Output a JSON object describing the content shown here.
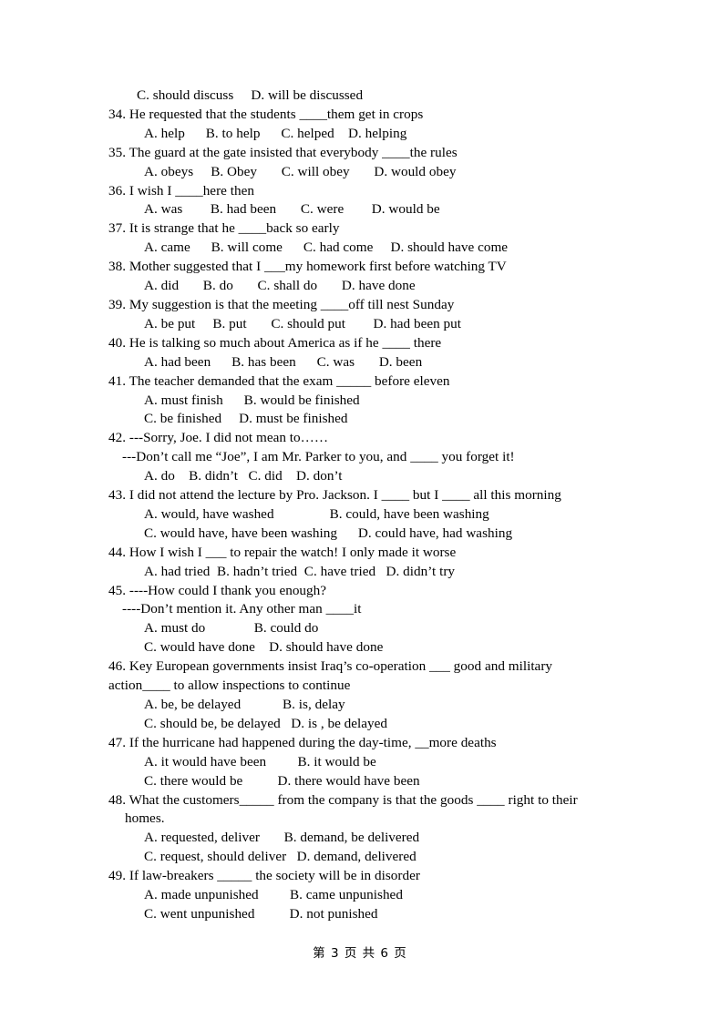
{
  "document": {
    "type": "exam-paper",
    "language": "en-with-zh-footer",
    "background_color": "#ffffff",
    "text_color": "#000000"
  },
  "lines": [
    {
      "id": "l01",
      "kind": "option",
      "text": "C. should discuss     D. will be discussed"
    },
    {
      "id": "l02",
      "kind": "question",
      "text": "34. He requested that the students ____them get in crops"
    },
    {
      "id": "l03",
      "kind": "option",
      "text": "A. help      B. to help      C. helped    D. helping"
    },
    {
      "id": "l04",
      "kind": "question",
      "text": "35. The guard at the gate insisted that everybody ____the rules"
    },
    {
      "id": "l05",
      "kind": "option",
      "text": "A. obeys     B. Obey       C. will obey       D. would obey"
    },
    {
      "id": "l06",
      "kind": "question",
      "text": "36. I wish I ____here then"
    },
    {
      "id": "l07",
      "kind": "option",
      "text": "A. was        B. had been       C. were        D. would be"
    },
    {
      "id": "l08",
      "kind": "question",
      "text": "37. It is strange that he ____back so early"
    },
    {
      "id": "l09",
      "kind": "option",
      "text": "A. came      B. will come      C. had come     D. should have come"
    },
    {
      "id": "l10",
      "kind": "question",
      "text": "38. Mother suggested that I ___my homework first before watching TV"
    },
    {
      "id": "l11",
      "kind": "option",
      "text": "A. did       B. do       C. shall do       D. have done"
    },
    {
      "id": "l12",
      "kind": "question",
      "text": "39. My suggestion is that the meeting ____off till nest Sunday"
    },
    {
      "id": "l13",
      "kind": "option",
      "text": "A. be put     B. put       C. should put        D. had been put"
    },
    {
      "id": "l14",
      "kind": "question",
      "text": "40. He is talking so much about America as if he ____ there"
    },
    {
      "id": "l15",
      "kind": "option",
      "text": "A. had been      B. has been      C. was       D. been"
    },
    {
      "id": "l16",
      "kind": "question",
      "text": "41. The teacher demanded that the exam _____ before eleven"
    },
    {
      "id": "l17",
      "kind": "option",
      "text": "A. must finish      B. would be finished"
    },
    {
      "id": "l18",
      "kind": "option",
      "text": "C. be finished     D. must be finished"
    },
    {
      "id": "l19",
      "kind": "question",
      "text": "42. ---Sorry, Joe. I did not mean to……"
    },
    {
      "id": "l20",
      "kind": "dialogue",
      "text": "---Don’t call me “Joe”, I am Mr. Parker to you, and ____ you forget it!"
    },
    {
      "id": "l21",
      "kind": "option",
      "text": "A. do    B. didn’t   C. did    D. don’t"
    },
    {
      "id": "l22",
      "kind": "question",
      "text": "43. I did not attend the lecture by Pro. Jackson. I ____ but I ____ all this morning"
    },
    {
      "id": "l23",
      "kind": "option",
      "text": "A. would, have washed                B. could, have been washing"
    },
    {
      "id": "l24",
      "kind": "option",
      "text": "C. would have, have been washing      D. could have, had washing"
    },
    {
      "id": "l25",
      "kind": "question",
      "text": "44. How I wish I ___ to repair the watch! I only made it worse"
    },
    {
      "id": "l26",
      "kind": "option",
      "text": "A. had tried  B. hadn’t tried  C. have tried   D. didn’t try"
    },
    {
      "id": "l27",
      "kind": "question",
      "text": "45. ----How could I thank you enough?"
    },
    {
      "id": "l28",
      "kind": "dialogue",
      "text": "----Don’t mention it. Any other man ____it"
    },
    {
      "id": "l29",
      "kind": "option",
      "text": "A. must do              B. could do"
    },
    {
      "id": "l30",
      "kind": "option",
      "text": "C. would have done    D. should have done"
    },
    {
      "id": "l31",
      "kind": "question",
      "text": "46. Key European governments insist Iraq’s co-operation ___ good and military"
    },
    {
      "id": "l32",
      "kind": "continuation",
      "text": "action____ to allow inspections to continue"
    },
    {
      "id": "l33",
      "kind": "option",
      "text": "A. be, be delayed            B. is, delay"
    },
    {
      "id": "l34",
      "kind": "option",
      "text": "C. should be, be delayed   D. is , be delayed"
    },
    {
      "id": "l35",
      "kind": "question",
      "text": "47. If the hurricane had happened during the day-time, __more deaths"
    },
    {
      "id": "l36",
      "kind": "option",
      "text": "A. it would have been         B. it would be"
    },
    {
      "id": "l37",
      "kind": "option",
      "text": "C. there would be          D. there would have been"
    },
    {
      "id": "l38",
      "kind": "question",
      "text": "48. What the customers_____ from the company is that the goods ____ right to their"
    },
    {
      "id": "l39",
      "kind": "continuation",
      "text": "homes."
    },
    {
      "id": "l40",
      "kind": "option",
      "text": "A. requested, deliver       B. demand, be delivered"
    },
    {
      "id": "l41",
      "kind": "option",
      "text": "C. request, should deliver   D. demand, delivered"
    },
    {
      "id": "l42",
      "kind": "question",
      "text": "49. If law-breakers _____ the society will be in disorder"
    },
    {
      "id": "l43",
      "kind": "option",
      "text": "A. made unpunished         B. came unpunished"
    },
    {
      "id": "l44",
      "kind": "option",
      "text": "C. went unpunished          D. not punished"
    }
  ],
  "footer": {
    "text": "第 3 页 共 6 页",
    "current_page": "3",
    "total_pages": "6"
  }
}
